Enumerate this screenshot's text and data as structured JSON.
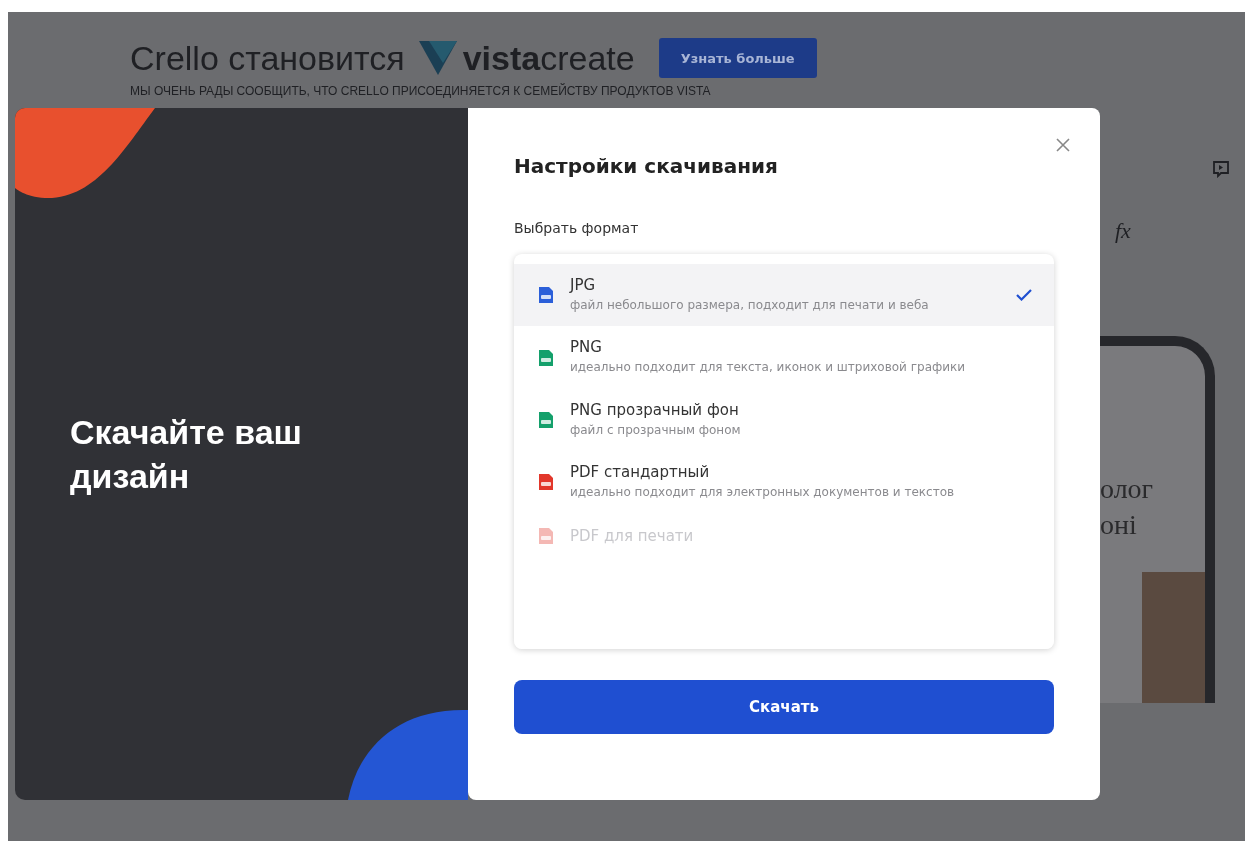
{
  "banner": {
    "headline": "Crello становится",
    "logo_bold": "vista",
    "logo_light": "create",
    "button": "Узнать больше",
    "subtitle": "МЫ ОЧЕНЬ РАДЫ СООБЩИТЬ, ЧТО CRELLO ПРИСОЕДИНЯЕТСЯ К СЕМЕЙСТВУ ПРОДУКТОВ VISTA"
  },
  "promo": {
    "title": "Скачайте ваш дизайн"
  },
  "dialog": {
    "title": "Настройки скачивания",
    "section_label": "Выбрать формат",
    "button": "Скачать",
    "formats": [
      {
        "kind": "jpg",
        "name": "JPG",
        "description": "файл небольшого размера, подходит для печати и веба",
        "selected": true
      },
      {
        "kind": "png",
        "name": "PNG",
        "description": "идеально подходит для текста, иконок и штриховой графики",
        "selected": false
      },
      {
        "kind": "png",
        "name": "PNG прозрачный фон",
        "description": "файл с прозрачным фоном",
        "selected": false
      },
      {
        "kind": "pdf",
        "name": "PDF стандартный",
        "description": "идеально подходит для электронных документов и текстов",
        "selected": false
      },
      {
        "kind": "pdf",
        "name": "PDF для печати",
        "selected": false
      }
    ]
  },
  "editor": {
    "effects_label": "fx",
    "preview_lines": [
      "олог",
      "оні"
    ]
  }
}
